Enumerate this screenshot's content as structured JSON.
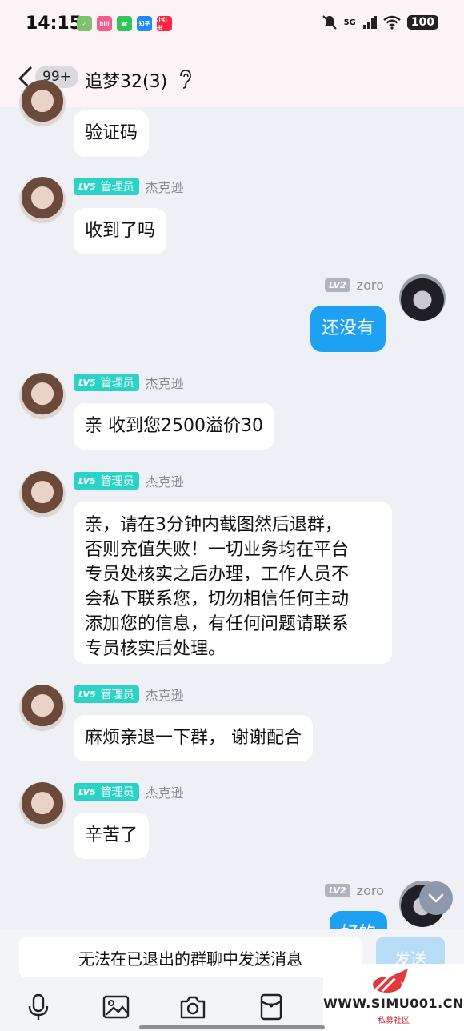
{
  "status_bar": {
    "time": "14:15",
    "apps": [
      {
        "name": "tasks-app-icon",
        "label": "✓",
        "color": "#7cc36b"
      },
      {
        "name": "bilibili-app-icon",
        "label": "bili",
        "color": "#f25d8e"
      },
      {
        "name": "phone-app-icon",
        "label": "☎",
        "color": "#2fc55a"
      },
      {
        "name": "zhihu-app-icon",
        "label": "知乎",
        "color": "#1e8cf0"
      },
      {
        "name": "xiaohongshu-app-icon",
        "label": "小红书",
        "color": "#ff2442"
      }
    ],
    "network": "5G",
    "battery": "100"
  },
  "header": {
    "unread_badge": "99+",
    "title": "追梦32(3)"
  },
  "messages": [
    {
      "sender": "杰克逊",
      "level": "LV5",
      "role": "管理员",
      "text": "验证码",
      "mine": false
    },
    {
      "sender": "杰克逊",
      "level": "LV5",
      "role": "管理员",
      "text": "收到了吗",
      "mine": false
    },
    {
      "sender": "zoro",
      "level": "LV2",
      "text": "还没有",
      "mine": true
    },
    {
      "sender": "杰克逊",
      "level": "LV5",
      "role": "管理员",
      "text": "亲 收到您2500溢价30",
      "mine": false
    },
    {
      "sender": "杰克逊",
      "level": "LV5",
      "role": "管理员",
      "text_lines": [
        "亲，请在3分钟内截图然后退群，",
        "否则充值失败！一切业务均在平台",
        "专员处核实之后办理，工作人员不",
        "会私下联系您，切勿相信任何主动",
        "添加您的信息，有任何问题请联系",
        "专员核实后处理。"
      ],
      "mine": false
    },
    {
      "sender": "杰克逊",
      "level": "LV5",
      "role": "管理员",
      "text": "麻烦亲退一下群， 谢谢配合",
      "mine": false
    },
    {
      "sender": "杰克逊",
      "level": "LV5",
      "role": "管理员",
      "text": "辛苦了",
      "mine": false
    },
    {
      "sender": "zoro",
      "level": "LV2",
      "text": "好的",
      "mine": true
    }
  ],
  "input": {
    "disabled_notice": "无法在已退出的群聊中发送消息",
    "send_label": "发送"
  },
  "toolbar": [
    "microphone-icon",
    "image-icon",
    "camera-icon",
    "red-packet-icon"
  ],
  "watermark": {
    "site": "WWW.SIMU001.CN",
    "subtitle": "私募社区"
  },
  "colors": {
    "accent": "#1ea1f2",
    "admin_badge": "#2bd3c6",
    "background": "#eef0f6"
  }
}
